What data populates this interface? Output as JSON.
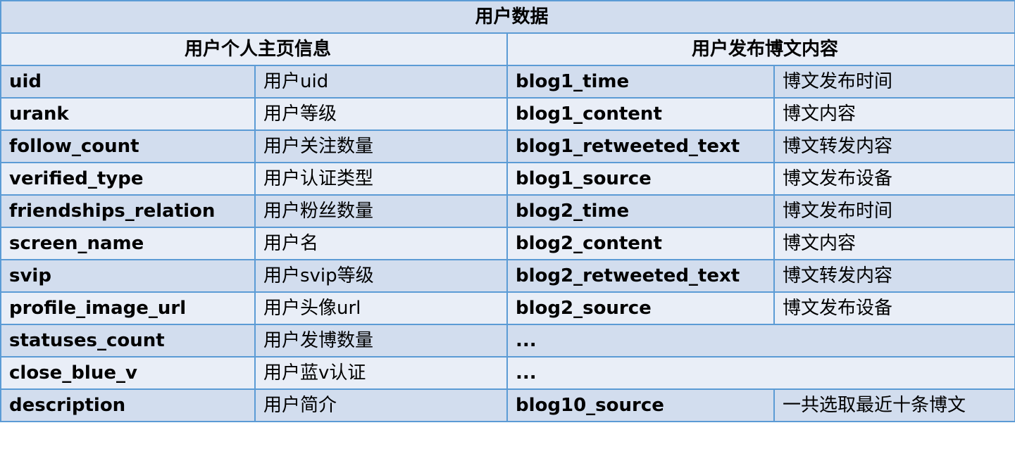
{
  "title": "用户数据",
  "sections": {
    "profile_header": "用户个人主页信息",
    "blog_header": "用户发布博文内容"
  },
  "rows": [
    {
      "profile_field": "uid",
      "profile_desc": "用户uid",
      "blog_field": "blog1_time",
      "blog_desc": "博文发布时间"
    },
    {
      "profile_field": "urank",
      "profile_desc": "用户等级",
      "blog_field": "blog1_content",
      "blog_desc": "博文内容"
    },
    {
      "profile_field": "follow_count",
      "profile_desc": "用户关注数量",
      "blog_field": "blog1_retweeted_text",
      "blog_desc": "博文转发内容"
    },
    {
      "profile_field": "verified_type",
      "profile_desc": "用户认证类型",
      "blog_field": "blog1_source",
      "blog_desc": "博文发布设备"
    },
    {
      "profile_field": "friendships_relation",
      "profile_desc": "用户粉丝数量",
      "blog_field": "blog2_time",
      "blog_desc": "博文发布时间"
    },
    {
      "profile_field": "screen_name",
      "profile_desc": "用户名",
      "blog_field": "blog2_content",
      "blog_desc": "博文内容"
    },
    {
      "profile_field": "svip",
      "profile_desc": "用户svip等级",
      "blog_field": "blog2_retweeted_text",
      "blog_desc": "博文转发内容"
    },
    {
      "profile_field": "profile_image_url",
      "profile_desc": "用户头像url",
      "blog_field": "blog2_source",
      "blog_desc": "博文发布设备"
    },
    {
      "profile_field": "statuses_count",
      "profile_desc": "用户发博数量",
      "blog_field": "..."
    },
    {
      "profile_field": "close_blue_v",
      "profile_desc": "用户蓝v认证",
      "blog_field": "..."
    },
    {
      "profile_field": "description",
      "profile_desc": "用户简介",
      "blog_field": "blog10_source",
      "blog_desc": "一共选取最近十条博文"
    }
  ]
}
